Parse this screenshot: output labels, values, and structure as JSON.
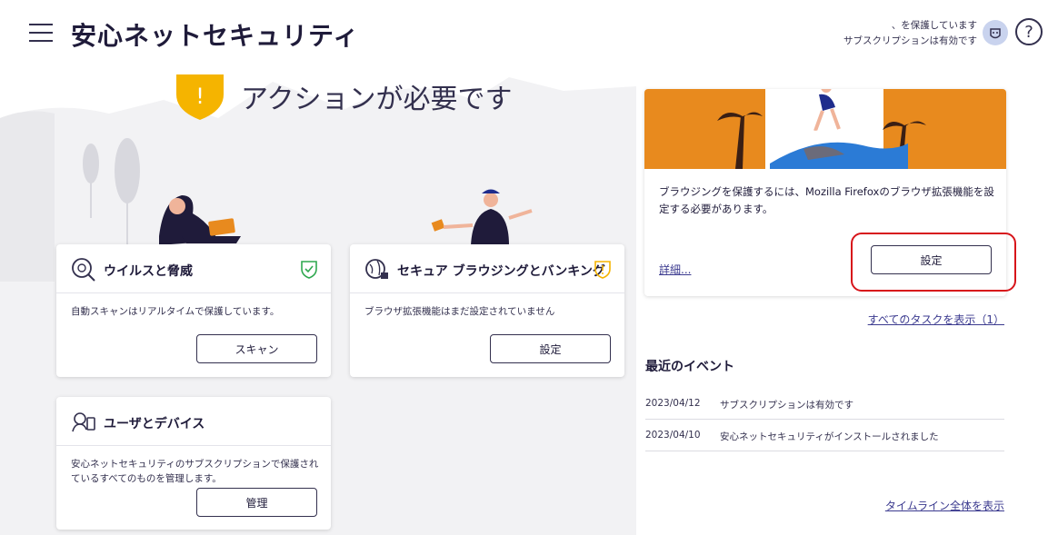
{
  "header": {
    "title": "安心ネットセキュリティ",
    "status_line1": "、を保護しています",
    "status_line2": "サブスクリプションは有効です",
    "help_label": "?"
  },
  "hero": {
    "warning_mark": "!",
    "title": "アクションが必要です"
  },
  "cards": {
    "virus": {
      "title": "ウイルスと脅威",
      "body": "自動スキャンはリアルタイムで保護しています。",
      "button": "スキャン"
    },
    "browsing": {
      "title": "セキュア ブラウジングとバンキング",
      "body": "ブラウザ拡張機能はまだ設定されていません",
      "button": "設定"
    },
    "devices": {
      "title": "ユーザとデバイス",
      "body": "安心ネットセキュリティのサブスクリプションで保護されているすべてのものを管理します。",
      "button": "管理"
    }
  },
  "promo": {
    "text": "ブラウジングを保護するには、Mozilla Firefoxのブラウザ拡張機能を設定する必要があります。",
    "details_link": "詳細...",
    "button": "設定"
  },
  "tasks": {
    "all_tasks_link": "すべてのタスクを表示（1）"
  },
  "events": {
    "title": "最近のイベント",
    "items": [
      {
        "date": "2023/04/12",
        "text": "サブスクリプションは有効です"
      },
      {
        "date": "2023/04/10",
        "text": "安心ネットセキュリティがインストールされました"
      }
    ],
    "timeline_link": "タイムライン全体を表示"
  },
  "colors": {
    "accent": "#33304e",
    "link": "#3b3a8f",
    "warning": "#f5b400",
    "ok": "#2fa84f",
    "promo_banner": "#e88a1e",
    "highlight": "#d7141a"
  }
}
